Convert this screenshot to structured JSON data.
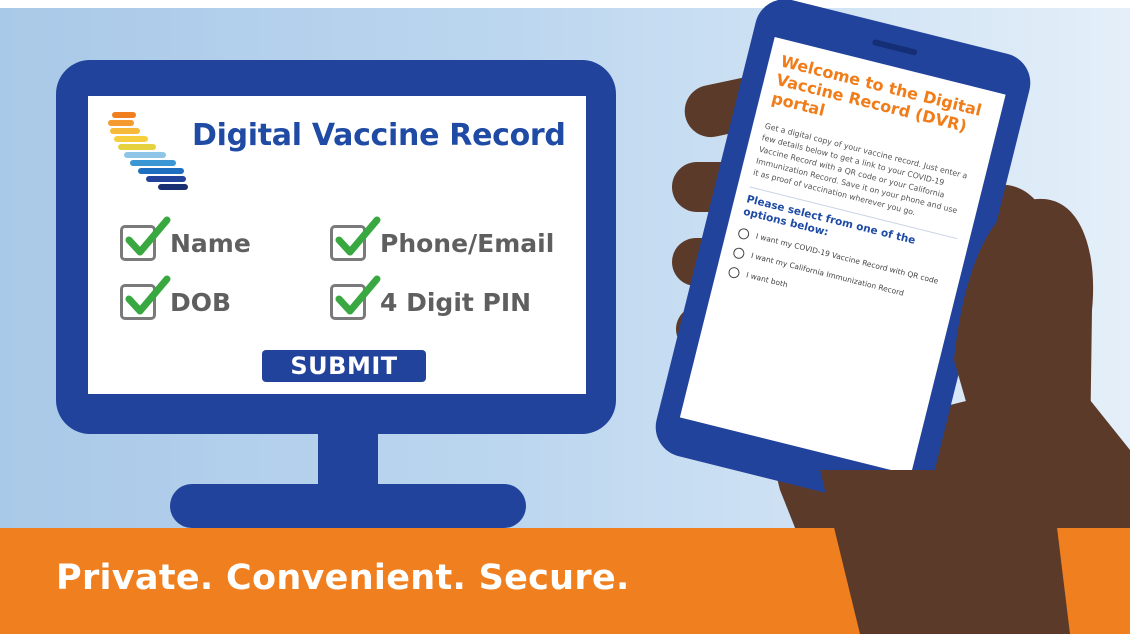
{
  "monitor": {
    "title": "Digital Vaccine Record",
    "fields": [
      {
        "label": "Name",
        "checked": true
      },
      {
        "label": "Phone/Email",
        "checked": true
      },
      {
        "label": "DOB",
        "checked": true
      },
      {
        "label": "4 Digit PIN",
        "checked": true
      }
    ],
    "submit_label": "SUBMIT",
    "logo_icon": "california-stripes-logo"
  },
  "phone": {
    "welcome": "Welcome to the Digital Vaccine Record (DVR) portal",
    "intro": "Get a digital copy of your vaccine record. Just enter a few details below to get a link to your COVID-19 Vaccine Record with a QR code or your California Immunization Record. Save it on your phone and use it as proof of vaccination wherever you go.",
    "select_prompt": "Please select from one of the options below:",
    "options": [
      "I want my COVID-19 Vaccine Record with QR code",
      "I want my California Immunization Record",
      "I want both"
    ]
  },
  "banner": {
    "tagline": "Private. Convenient. Secure."
  },
  "colors": {
    "navy": "#22439c",
    "orange": "#f07f20",
    "check_green": "#3aa841",
    "skin": "#5c3a2a"
  }
}
